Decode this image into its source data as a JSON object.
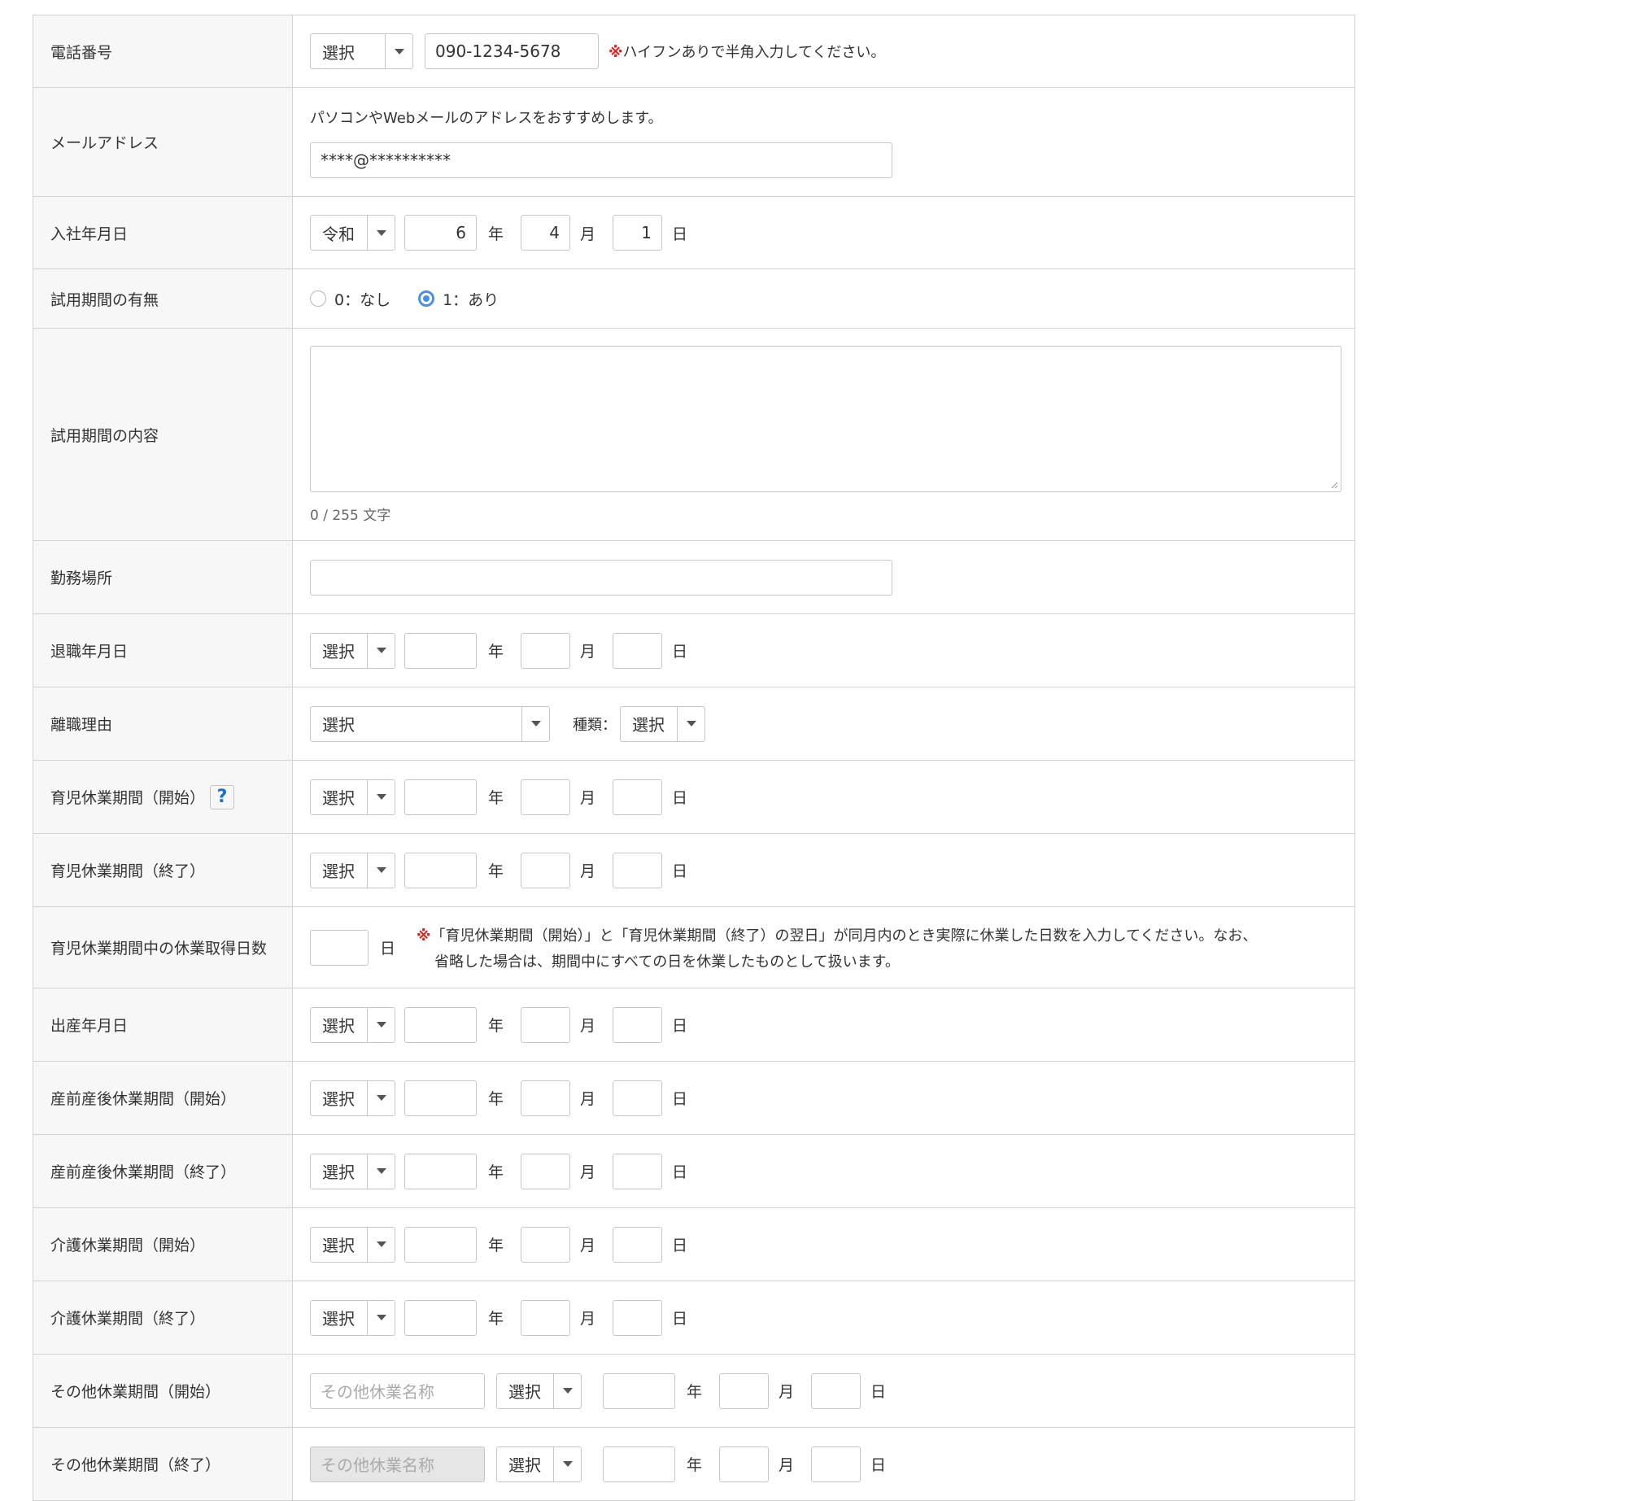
{
  "form": {
    "phone": {
      "label": "電話番号",
      "type_select": "選択",
      "value": "090-1234-5678",
      "note_mark": "※",
      "note": "ハイフンありで半角入力してください。"
    },
    "email": {
      "label": "メールアドレス",
      "hint": "パソコンやWebメールのアドレスをおすすめします。",
      "value": "****@**********"
    },
    "hire_date": {
      "label": "入社年月日",
      "era": "令和",
      "year": "6",
      "month": "4",
      "day": "1"
    },
    "probation": {
      "label": "試用期間の有無",
      "options": [
        "0：なし",
        "1：あり"
      ],
      "selected_index": 1
    },
    "probation_detail": {
      "label": "試用期間の内容",
      "value": "",
      "counter": "0 / 255 文字"
    },
    "workplace": {
      "label": "勤務場所",
      "value": ""
    },
    "retire_date": {
      "label": "退職年月日",
      "era": "選択"
    },
    "leave_reason": {
      "label": "離職理由",
      "reason": "選択",
      "kind_label": "種類：",
      "kind": "選択"
    },
    "childcare_start": {
      "label": "育児休業期間（開始）",
      "era": "選択",
      "help": "?"
    },
    "childcare_end": {
      "label": "育児休業期間（終了）",
      "era": "選択"
    },
    "childcare_days": {
      "label": "育児休業期間中の休業取得日数",
      "unit": "日",
      "note_mark": "※",
      "note_line1": "「育児休業期間（開始）」と「育児休業期間（終了）の翌日」が同月内のとき実際に休業した日数を入力してください。なお、",
      "note_line2": "省略した場合は、期間中にすべての日を休業したものとして扱います。"
    },
    "birth_date": {
      "label": "出産年月日",
      "era": "選択"
    },
    "maternity_start": {
      "label": "産前産後休業期間（開始）",
      "era": "選択"
    },
    "maternity_end": {
      "label": "産前産後休業期間（終了）",
      "era": "選択"
    },
    "care_start": {
      "label": "介護休業期間（開始）",
      "era": "選択"
    },
    "care_end": {
      "label": "介護休業期間（終了）",
      "era": "選択"
    },
    "other_start": {
      "label": "その他休業期間（開始）",
      "name_placeholder": "その他休業名称",
      "era": "選択"
    },
    "other_end": {
      "label": "その他休業期間（終了）",
      "name_placeholder": "その他休業名称",
      "era": "選択"
    }
  },
  "units": {
    "year": "年",
    "month": "月",
    "day": "日"
  }
}
